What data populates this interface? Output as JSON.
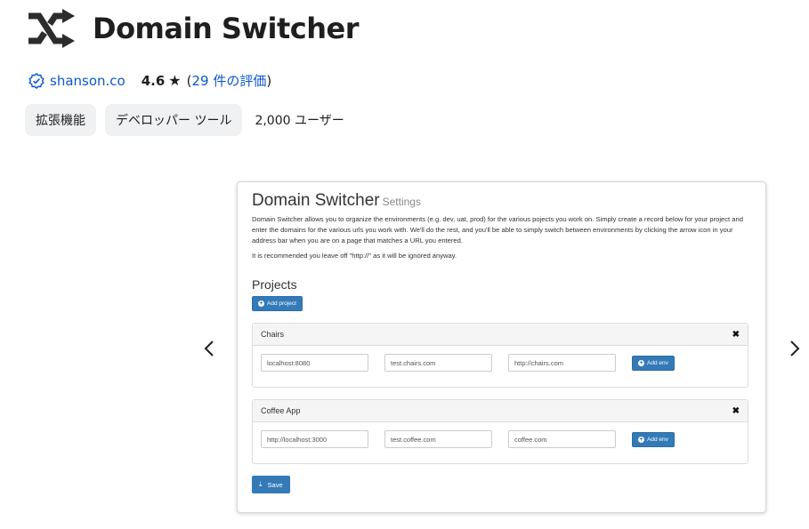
{
  "header": {
    "title": "Domain Switcher",
    "logo_icon": "shuffle-icon"
  },
  "meta": {
    "publisher": "shanson.co",
    "verified_icon": "verified-badge-icon",
    "rating": "4.6",
    "star": "★",
    "reviews_open": "(",
    "reviews_link": "29 件の評価",
    "reviews_close": ")"
  },
  "chips": [
    "拡張機能",
    "デベロッパー ツール"
  ],
  "users": "2,000 ユーザー",
  "carousel": {
    "prev_icon": "chevron-left-icon",
    "next_icon": "chevron-right-icon"
  },
  "screenshot": {
    "title": "Domain Switcher",
    "subtitle": "Settings",
    "description": "Domain Switcher allows you to organize the environments (e.g. dev, uat, prod) for the various pojects you work on. Simply create a record below for your project and enter the domains for the various urls you work with. We'll do the rest, and you'll be able to simply switch between environments by clicking the arrow icon in your address bar when you are on a page that matches a URL you entered.",
    "note": "It is recommended you leave off \"http://\" as it will be ignored anyway.",
    "projects_heading": "Projects",
    "add_project_label": "Add project",
    "add_env_label": "Add env",
    "save_label": "Save",
    "projects": [
      {
        "name": "Chairs",
        "domains": [
          "localhost:8080",
          "test.chairs.com",
          "http://chairs.com"
        ]
      },
      {
        "name": "Coffee App",
        "domains": [
          "http://localhost:3000",
          "test.coffee.com",
          "coffee.com"
        ]
      }
    ]
  },
  "colors": {
    "link": "#0b57d0",
    "chip_bg": "#eff1f3",
    "bootstrap_primary": "#337ab7"
  }
}
